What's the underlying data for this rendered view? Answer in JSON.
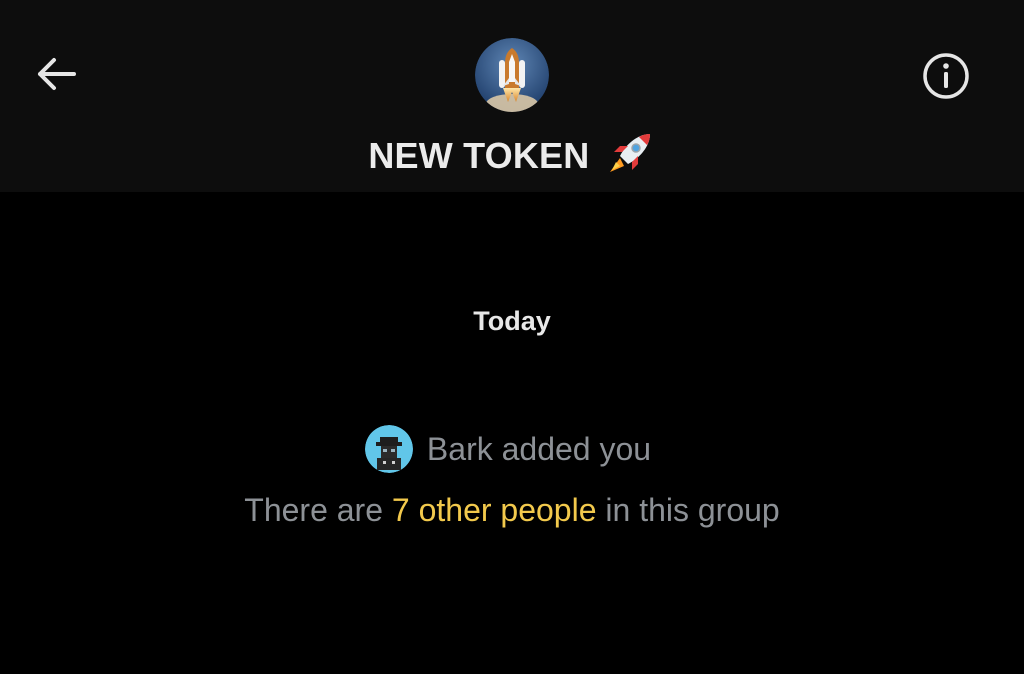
{
  "header": {
    "title": "NEW TOKEN",
    "title_emoji": "rocket-emoji",
    "back_icon": "arrow-left-icon",
    "info_icon": "info-circle-icon",
    "group_avatar": "space-shuttle-avatar"
  },
  "conversation": {
    "date_separator": "Today",
    "system_message": {
      "avatar": "bark-avatar",
      "text": "Bark added you"
    },
    "group_info": {
      "prefix": "There are ",
      "link": "7 other people",
      "suffix": " in this group"
    }
  },
  "colors": {
    "background": "#000000",
    "header_background": "#0d0d0d",
    "primary_text": "#ebebeb",
    "secondary_text": "#8d9196",
    "link": "#f2c94c"
  }
}
